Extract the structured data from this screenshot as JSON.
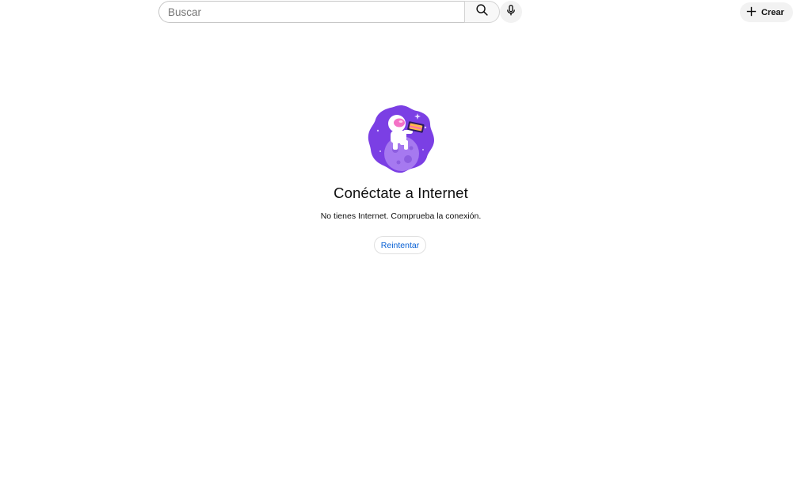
{
  "header": {
    "search": {
      "placeholder": "Buscar",
      "value": "",
      "search_icon": "search-icon",
      "mic_icon": "microphone-icon"
    },
    "create_button": {
      "label": "Crear",
      "icon": "plus-icon"
    }
  },
  "offline": {
    "illustration": "astronaut-on-planet-illustration",
    "title": "Conéctate a Internet",
    "message": "No tienes Internet. Comprueba la conexión.",
    "retry_label": "Reintentar"
  },
  "colors": {
    "accent_link": "#065fd4",
    "illustration_purple": "#7b3fe4",
    "illustration_planet": "#a679f0"
  }
}
